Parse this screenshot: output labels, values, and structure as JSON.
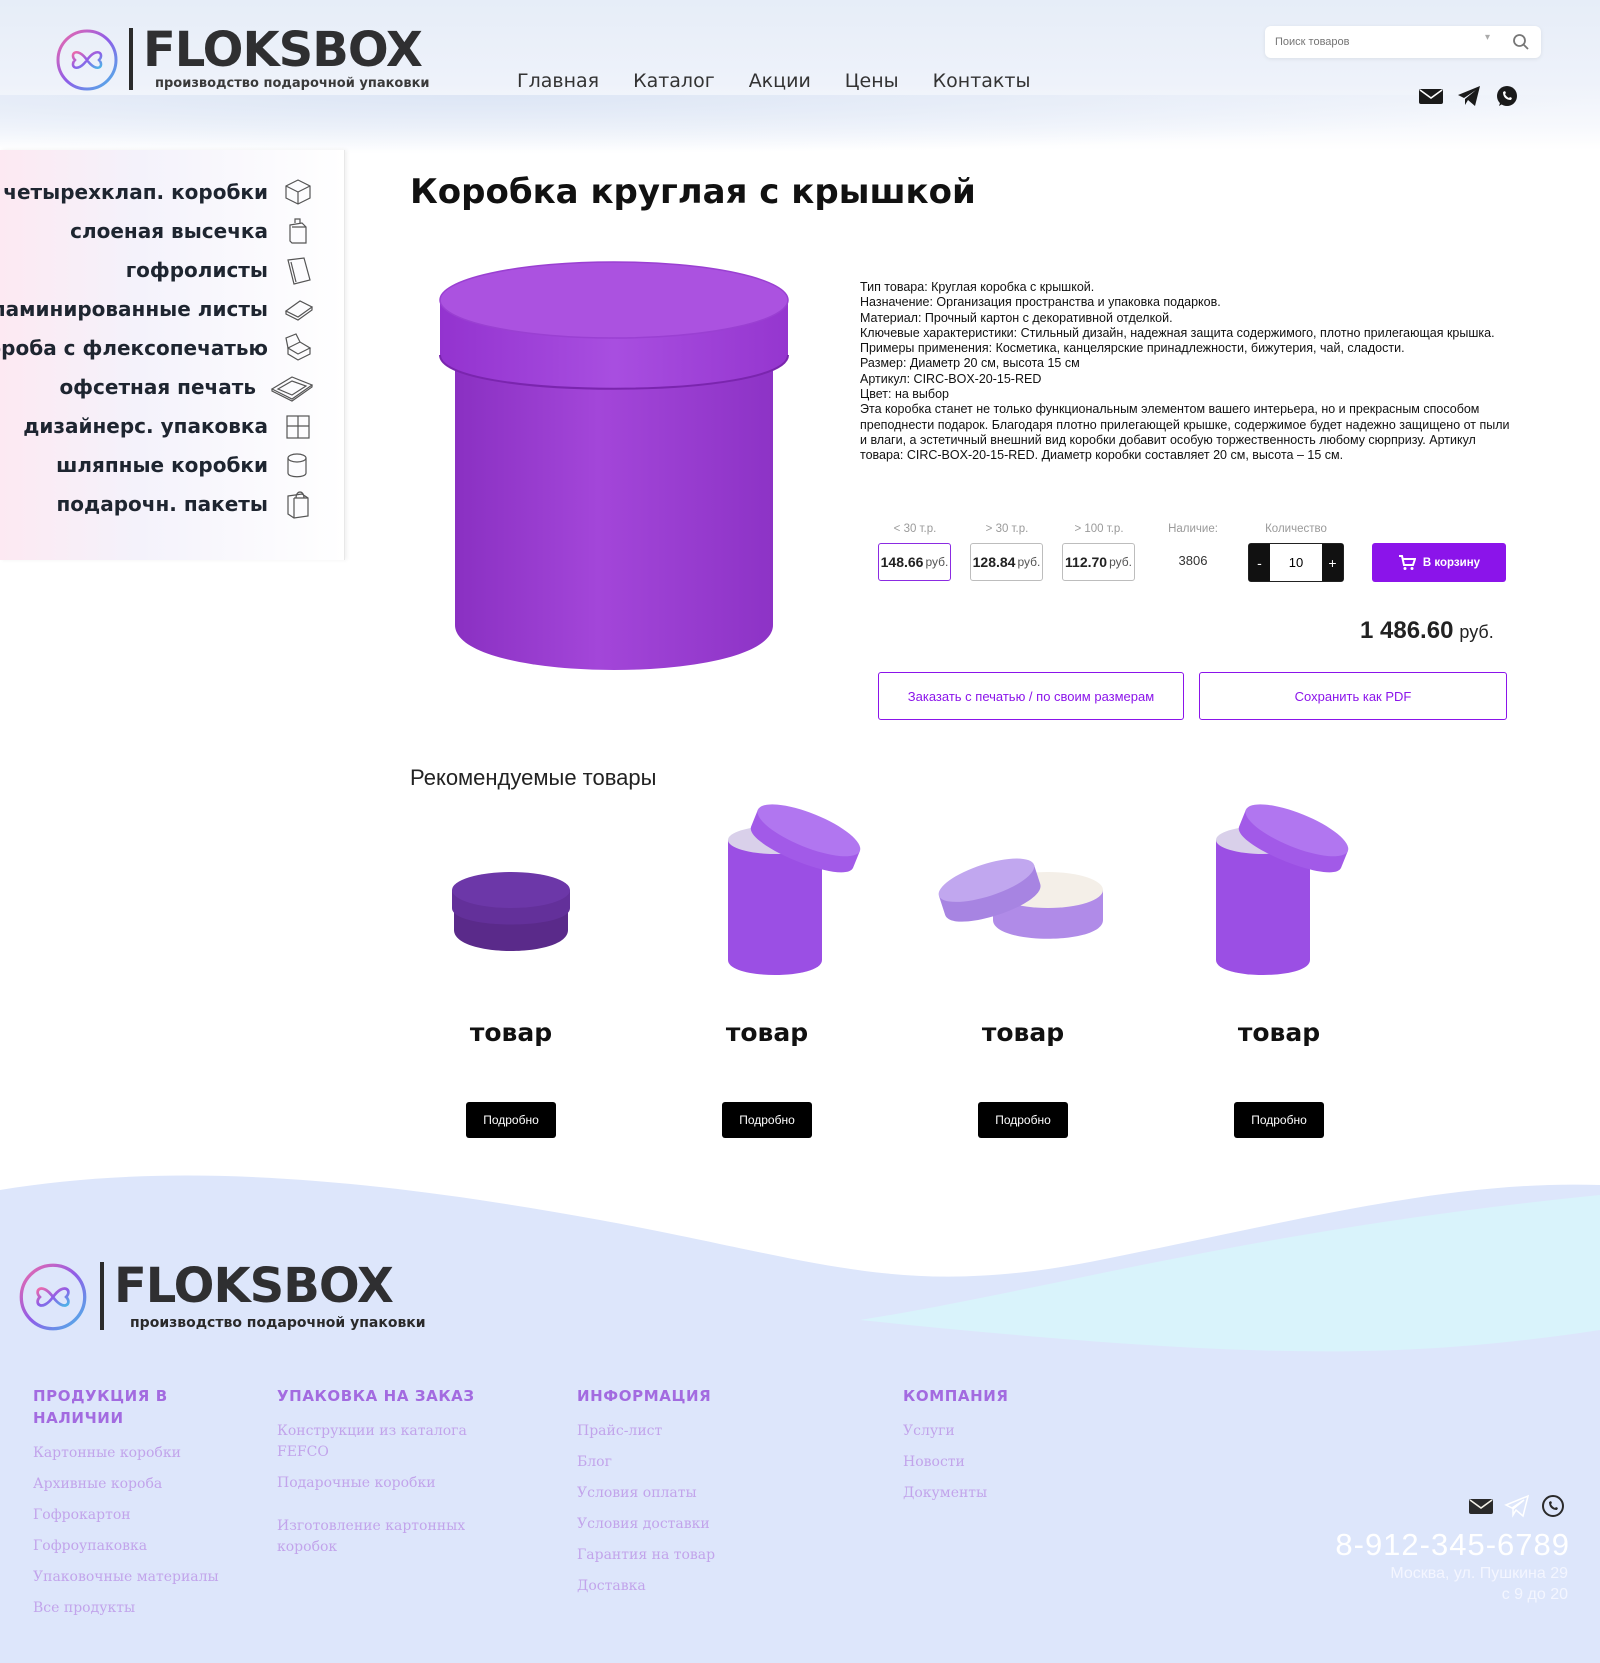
{
  "header": {
    "logo_name": "FLOKSBOX",
    "logo_tagline": "производство подарочной упаковки",
    "nav": [
      "Главная",
      "Каталог",
      "Акции",
      "Цены",
      "Контакты"
    ],
    "search_placeholder": "Поиск товаров",
    "icons": [
      "mail-icon",
      "telegram-icon",
      "whatsapp-icon"
    ]
  },
  "sidebar": {
    "items": [
      {
        "label": "четырехклап. коробки",
        "icon": "box-icon"
      },
      {
        "label": "слоеная высечка",
        "icon": "bag-box-icon"
      },
      {
        "label": "гофролисты",
        "icon": "sheet-icon"
      },
      {
        "label": "ламинированные листы",
        "icon": "laminated-sheet-icon"
      },
      {
        "label": "короба с флексопечатью",
        "icon": "open-box-icon"
      },
      {
        "label": "офсетная печать",
        "icon": "flat-sheet-icon"
      },
      {
        "label": "дизайнерс. упаковка",
        "icon": "gift-box-icon"
      },
      {
        "label": "шляпные коробки",
        "icon": "hat-box-icon"
      },
      {
        "label": "подарочн. пакеты",
        "icon": "gift-bag-icon"
      }
    ]
  },
  "product": {
    "title": "Коробка круглая с крышкой",
    "description": [
      " Тип товара: Круглая коробка с крышкой.",
      "Назначение: Организация пространства и упаковка подарков.",
      " Материал: Прочный картон с декоративной отделкой.",
      "Ключевые характеристики: Стильный дизайн, надежная защита содержимого, плотно прилегающая крышка.",
      " Примеры применения: Косметика, канцелярские принадлежности, бижутерия, чай, сладости.",
      " Размер: Диаметр 20 см, высота 15 см",
      " Артикул: CIRC-BOX-20-15-RED",
      "Цвет: на выбор",
      "Эта коробка станет не только функциональным элементом вашего интерьера, но и прекрасным способом преподнести подарок. Благодаря плотно прилегающей крышке, содержимое будет надежно защищено от пыли и влаги, а эстетичный внешний вид коробки добавит особую торжественность любому сюрпризу. Артикул товара: CIRC-BOX-20-15-RED. Диаметр коробки составляет 20 см, высота – 15 см."
    ],
    "price_tiers": [
      {
        "label": "< 30 т.р.",
        "price": "148.66",
        "currency": "руб."
      },
      {
        "label": "> 30 т.р.",
        "price": "128.84",
        "currency": "руб."
      },
      {
        "label": "> 100 т.р.",
        "price": "112.70",
        "currency": "руб."
      }
    ],
    "stock_label": "Наличие:",
    "stock_value": "3806",
    "quantity_label": "Количество",
    "quantity_value": "10",
    "qty_minus": "-",
    "qty_plus": "+",
    "cart_button": "В корзину",
    "total_value": "1 486.60",
    "total_currency": "руб.",
    "order_print_button": "Заказать с печатью / по своим размерам",
    "save_pdf_button": "Сохранить как PDF",
    "accent_color": "#8b14ea",
    "box_color": "#9b3fd0"
  },
  "recommended": {
    "title": "Рекомендуемые товары",
    "items": [
      {
        "name": "товар",
        "button": "Подробно"
      },
      {
        "name": "товар",
        "button": "Подробно"
      },
      {
        "name": "товар",
        "button": "Подробно"
      },
      {
        "name": "товар",
        "button": "Подробно"
      }
    ]
  },
  "footer": {
    "logo_name": "FLOKSBOX",
    "logo_tagline": "производство подарочной упаковки",
    "columns": [
      {
        "title": "ПРОДУКЦИЯ В НАЛИЧИИ",
        "links": [
          "Картонные коробки",
          "Архивные короба",
          "Гофрокартон",
          "Гофроупаковка",
          "Упаковочные материалы",
          "Все продукты"
        ]
      },
      {
        "title": "УПАКОВКА НА ЗАКАЗ",
        "links": [
          "Конструкции из каталога FEFCO",
          "Подарочные коробки",
          "Изготовление картонных коробок"
        ]
      },
      {
        "title": "ИНФОРМАЦИЯ",
        "links": [
          "Прайс-лист",
          "Блог",
          "Условия оплаты",
          "Условия доставки",
          "Гарантия на товар",
          "Доставка"
        ]
      },
      {
        "title": "КОМПАНИЯ",
        "links": [
          "Услуги",
          "Новости",
          "Документы"
        ]
      }
    ],
    "icons": [
      "mail-icon",
      "telegram-icon",
      "whatsapp-icon"
    ],
    "phone": "8-912-345-6789",
    "address": "Москва, ул. Пушкина 29",
    "hours": "с 9 до 20"
  }
}
